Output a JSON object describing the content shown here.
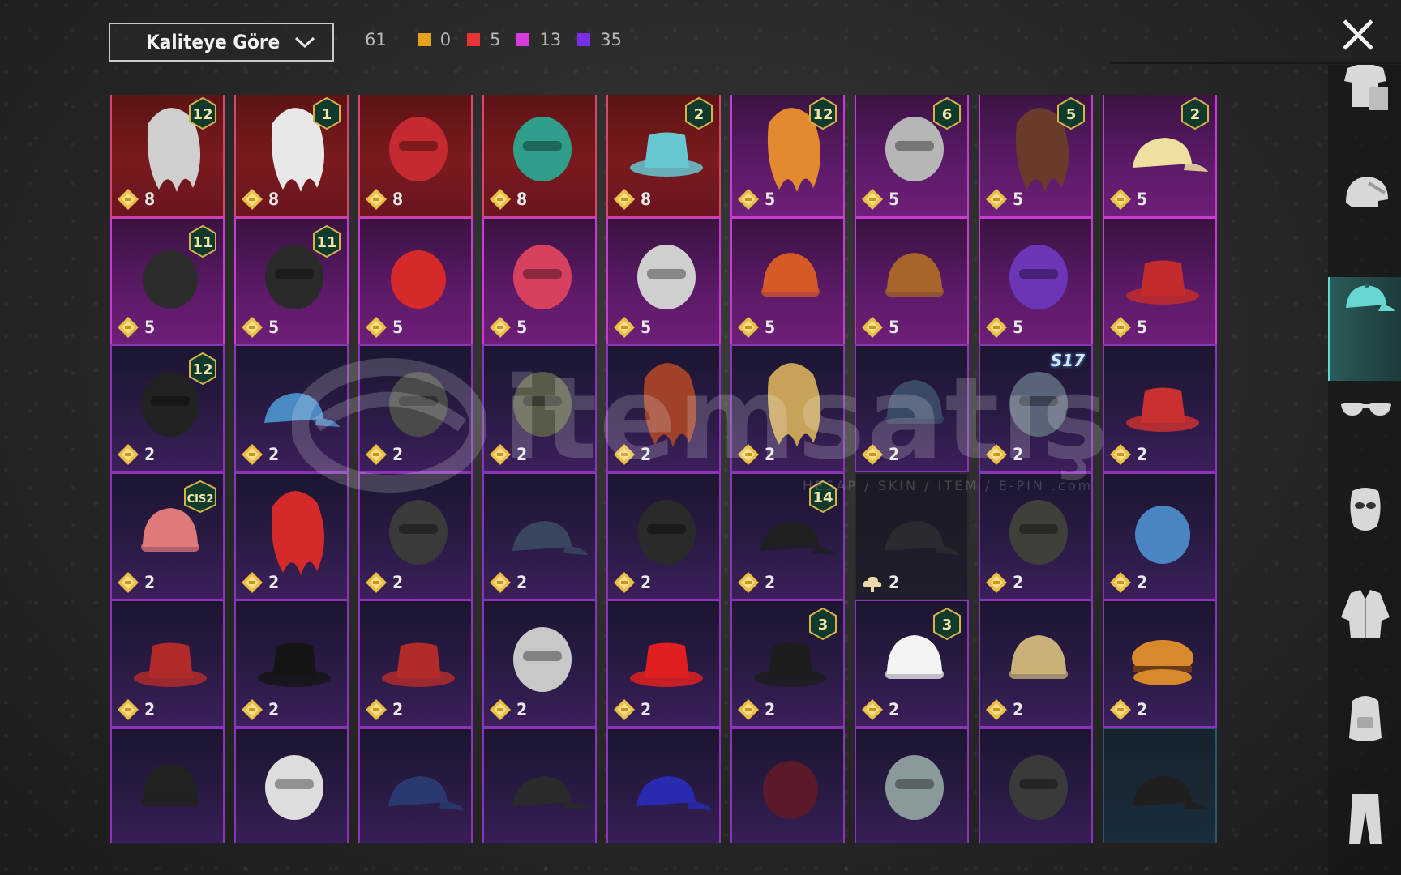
{
  "header": {
    "sort_label": "Kaliteye Göre",
    "total_count": "61",
    "rarity_counts": [
      {
        "color": "#e7a21c",
        "value": "0"
      },
      {
        "color": "#e83434",
        "value": "5"
      },
      {
        "color": "#d63ad9",
        "value": "13"
      },
      {
        "color": "#7a2ee6",
        "value": "35"
      }
    ]
  },
  "watermark": {
    "brand": "itemsatış",
    "tagline": "HESAP / SKIN / ITEM / E-PIN",
    "domain": ".com"
  },
  "grid": {
    "rows": [
      [
        {
          "price": "8",
          "rarity": "legendary",
          "art": "white-fur-hat-icon",
          "badge": "12"
        },
        {
          "price": "8",
          "rarity": "legendary",
          "art": "white-hair-icon",
          "badge": "1"
        },
        {
          "price": "8",
          "rarity": "legendary",
          "art": "red-helmet-icon"
        },
        {
          "price": "8",
          "rarity": "legendary",
          "art": "dragon-mask-icon"
        },
        {
          "price": "8",
          "rarity": "legendary",
          "art": "bucket-hat-icon",
          "badge": "2"
        },
        {
          "price": "5",
          "rarity": "epic",
          "art": "orange-hair-icon",
          "badge": "12"
        },
        {
          "price": "5",
          "rarity": "epic",
          "art": "knight-helmet-icon",
          "badge": "6"
        },
        {
          "price": "5",
          "rarity": "epic",
          "art": "bunny-hair-icon",
          "badge": "5"
        },
        {
          "price": "5",
          "rarity": "epic",
          "art": "blonde-hair-cap-icon",
          "badge": "2"
        }
      ],
      [
        {
          "price": "5",
          "rarity": "epic",
          "art": "royal-hat-icon",
          "badge": "11"
        },
        {
          "price": "5",
          "rarity": "epic",
          "art": "dark-mask-icon",
          "badge": "11"
        },
        {
          "price": "5",
          "rarity": "epic",
          "art": "santa-hat-icon"
        },
        {
          "price": "5",
          "rarity": "epic",
          "art": "phoenix-mask-icon"
        },
        {
          "price": "5",
          "rarity": "epic",
          "art": "lion-mask-icon"
        },
        {
          "price": "5",
          "rarity": "epic",
          "art": "orange-bandana-icon"
        },
        {
          "price": "5",
          "rarity": "epic",
          "art": "turban-icon"
        },
        {
          "price": "5",
          "rarity": "epic",
          "art": "purple-helmet-icon"
        },
        {
          "price": "5",
          "rarity": "epic",
          "art": "flower-top-hat-icon"
        }
      ],
      [
        {
          "price": "2",
          "rarity": "rare",
          "art": "bunny-helmet-icon",
          "badge": "12"
        },
        {
          "price": "2",
          "rarity": "rare",
          "art": "baseball-cap-icon"
        },
        {
          "price": "2",
          "rarity": "rare",
          "art": "gas-helmet-icon"
        },
        {
          "price": "2",
          "rarity": "rare",
          "art": "tactical-helmet-icon"
        },
        {
          "price": "2",
          "rarity": "rare",
          "art": "goggles-hair-icon"
        },
        {
          "price": "2",
          "rarity": "rare",
          "art": "blonde-hair-icon"
        },
        {
          "price": "2",
          "rarity": "rare",
          "art": "beanie-icon"
        },
        {
          "price": "2",
          "rarity": "rare",
          "art": "horned-helmet-icon",
          "s17": "S17"
        },
        {
          "price": "2",
          "rarity": "rare",
          "art": "fez-icon"
        }
      ],
      [
        {
          "price": "2",
          "rarity": "rare",
          "art": "striped-beanie-icon",
          "badge": "CIS2"
        },
        {
          "price": "2",
          "rarity": "rare",
          "art": "red-mohawk-icon"
        },
        {
          "price": "2",
          "rarity": "rare",
          "art": "braided-helmet-icon"
        },
        {
          "price": "2",
          "rarity": "rare",
          "art": "navy-cap-icon"
        },
        {
          "price": "2",
          "rarity": "rare",
          "art": "gas-mask-icon"
        },
        {
          "price": "2",
          "rarity": "rare",
          "art": "police-cap-icon",
          "badge": "14"
        },
        {
          "price": "2",
          "rarity": "dark",
          "art": "black-cap-icon",
          "currency": "cloud"
        },
        {
          "price": "2",
          "rarity": "rare",
          "art": "ninja-mask-icon"
        },
        {
          "price": "2",
          "rarity": "rare",
          "art": "shark-hat-icon"
        }
      ],
      [
        {
          "price": "2",
          "rarity": "rare",
          "art": "red-beret-icon"
        },
        {
          "price": "2",
          "rarity": "rare",
          "art": "black-top-hat-icon"
        },
        {
          "price": "2",
          "rarity": "rare",
          "art": "red-fedora-icon"
        },
        {
          "price": "2",
          "rarity": "rare",
          "art": "shark-head-icon"
        },
        {
          "price": "2",
          "rarity": "rare",
          "art": "red-bucket-hat-icon"
        },
        {
          "price": "2",
          "rarity": "rare",
          "art": "black-fedora-icon",
          "badge": "3"
        },
        {
          "price": "2",
          "rarity": "rare",
          "art": "flower-crown-icon",
          "badge": "3"
        },
        {
          "price": "2",
          "rarity": "rare",
          "art": "knit-beanie-icon"
        },
        {
          "price": "2",
          "rarity": "rare",
          "art": "burger-hat-icon"
        }
      ],
      [
        {
          "rarity": "rare",
          "art": "black-beanie-icon"
        },
        {
          "rarity": "rare",
          "art": "headlamp-icon"
        },
        {
          "rarity": "rare",
          "art": "blue-cap-icon"
        },
        {
          "rarity": "rare",
          "art": "graffiti-cap-icon"
        },
        {
          "rarity": "rare",
          "art": "purple-cap-icon"
        },
        {
          "rarity": "rare",
          "art": "maroon-hat-icon"
        },
        {
          "rarity": "rare",
          "art": "checkered-helmet-icon"
        },
        {
          "rarity": "rare",
          "art": "goggles-helmet-icon"
        },
        {
          "rarity": "blue",
          "art": "dark-cap-icon"
        }
      ]
    ]
  },
  "sidebar": {
    "tabs": [
      {
        "name": "outfit-icon"
      },
      {
        "name": "helmet-icon"
      },
      {
        "name": "hat-icon",
        "active": true
      },
      {
        "name": "glasses-icon"
      },
      {
        "name": "mask-icon"
      },
      {
        "name": "jacket-icon"
      },
      {
        "name": "backpack-icon"
      },
      {
        "name": "pants-icon"
      }
    ]
  }
}
